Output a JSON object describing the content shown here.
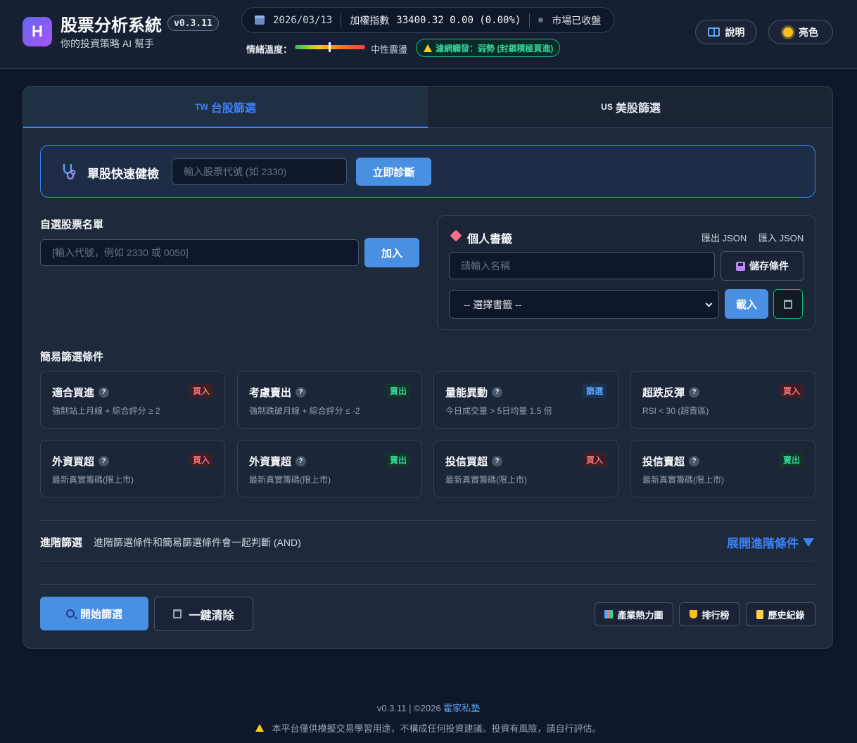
{
  "header": {
    "logo_letter": "H",
    "title": "股票分析系統",
    "version": "v0.3.11",
    "subtitle": "你的投資策略 AI 幫手",
    "date": "2026/03/13",
    "index_label": "加權指數",
    "index_value": "33400.32 0.00 (0.00%)",
    "market_status": "市場已收盤",
    "sentiment_label": "情緒溫度：",
    "sentiment_value": "中性震盪",
    "alert_text": "濾網觸發：弱勢 (封鎖積極買進)",
    "help_button": "說明",
    "theme_button": "亮色"
  },
  "tabs": {
    "tw_prefix": "TW",
    "tw_label": "台股篩選",
    "us_prefix": "US",
    "us_label": "美股篩選"
  },
  "quick_check": {
    "title": "單股快速健檢",
    "placeholder": "輸入股票代號 (如 2330)",
    "button": "立即診斷"
  },
  "watchlist": {
    "title": "自選股票名單",
    "placeholder": "[輸入代號，例如 2330 或 0050]",
    "add_button": "加入"
  },
  "bookmarks": {
    "title": "個人書籤",
    "export": "匯出 JSON",
    "import": "匯入 JSON",
    "name_placeholder": "請輸入名稱",
    "save_button": "儲存條件",
    "select_value": "-- 選擇書籤 --",
    "load_button": "載入"
  },
  "simple_filters": {
    "title": "簡易篩選條件",
    "help_glyph": "?",
    "cards": [
      {
        "title": "適合買進",
        "badge": "買入",
        "badge_type": "buy",
        "desc": "強制站上月線 + 綜合評分 ≥ 2"
      },
      {
        "title": "考慮賣出",
        "badge": "賣出",
        "badge_type": "sell",
        "desc": "強制跌破月線 + 綜合評分 ≤ -2"
      },
      {
        "title": "量能異動",
        "badge": "篩選",
        "badge_type": "filter",
        "desc": "今日成交量 > 5日均量 1.5 倍"
      },
      {
        "title": "超跌反彈",
        "badge": "買入",
        "badge_type": "buy",
        "desc": "RSI < 30 (超賣區)"
      },
      {
        "title": "外資買超",
        "badge": "買入",
        "badge_type": "buy",
        "desc": "最新真實籌碼(限上市)"
      },
      {
        "title": "外資賣超",
        "badge": "賣出",
        "badge_type": "sell",
        "desc": "最新真實籌碼(限上市)"
      },
      {
        "title": "投信買超",
        "badge": "買入",
        "badge_type": "buy",
        "desc": "最新真實籌碼(限上市)"
      },
      {
        "title": "投信賣超",
        "badge": "賣出",
        "badge_type": "sell",
        "desc": "最新真實籌碼(限上市)"
      }
    ]
  },
  "advanced": {
    "title": "進階篩選",
    "desc": "進階篩選條件和簡易篩選條件會一起判斷 (AND)",
    "toggle": "展開進階條件"
  },
  "actions": {
    "start": "開始篩選",
    "clear": "一鍵清除",
    "heatmap": "產業熱力圖",
    "ranking": "排行榜",
    "history": "歷史紀錄"
  },
  "footer": {
    "version_text": "v0.3.11 | ©2026",
    "brand": "霍家私塾",
    "disclaimer": "本平台僅供模擬交易學習用途，不構成任何投資建議。投資有風險，請自行評估。"
  }
}
